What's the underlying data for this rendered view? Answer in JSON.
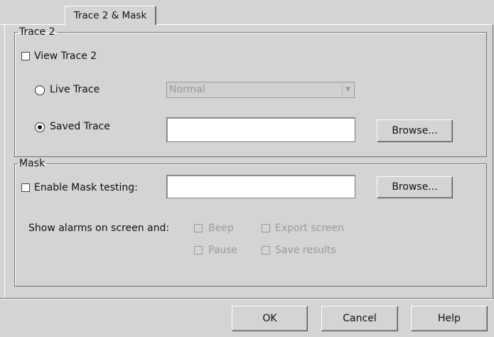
{
  "tab": {
    "label": "Trace 2 & Mask"
  },
  "trace2": {
    "legend": "Trace 2",
    "view_label": "View Trace 2",
    "live_label": "Live Trace",
    "live_select_value": "Normal",
    "saved_label": "Saved Trace",
    "saved_value": "",
    "browse_label": "Browse..."
  },
  "mask": {
    "legend": "Mask",
    "enable_label": "Enable Mask testing:",
    "mask_value": "",
    "browse_label": "Browse...",
    "alarms_label": "Show alarms on screen and:",
    "options": {
      "beep": "Beep",
      "export_screen": "Export screen",
      "pause": "Pause",
      "save_results": "Save results"
    }
  },
  "footer": {
    "ok": "OK",
    "cancel": "Cancel",
    "help": "Help"
  }
}
